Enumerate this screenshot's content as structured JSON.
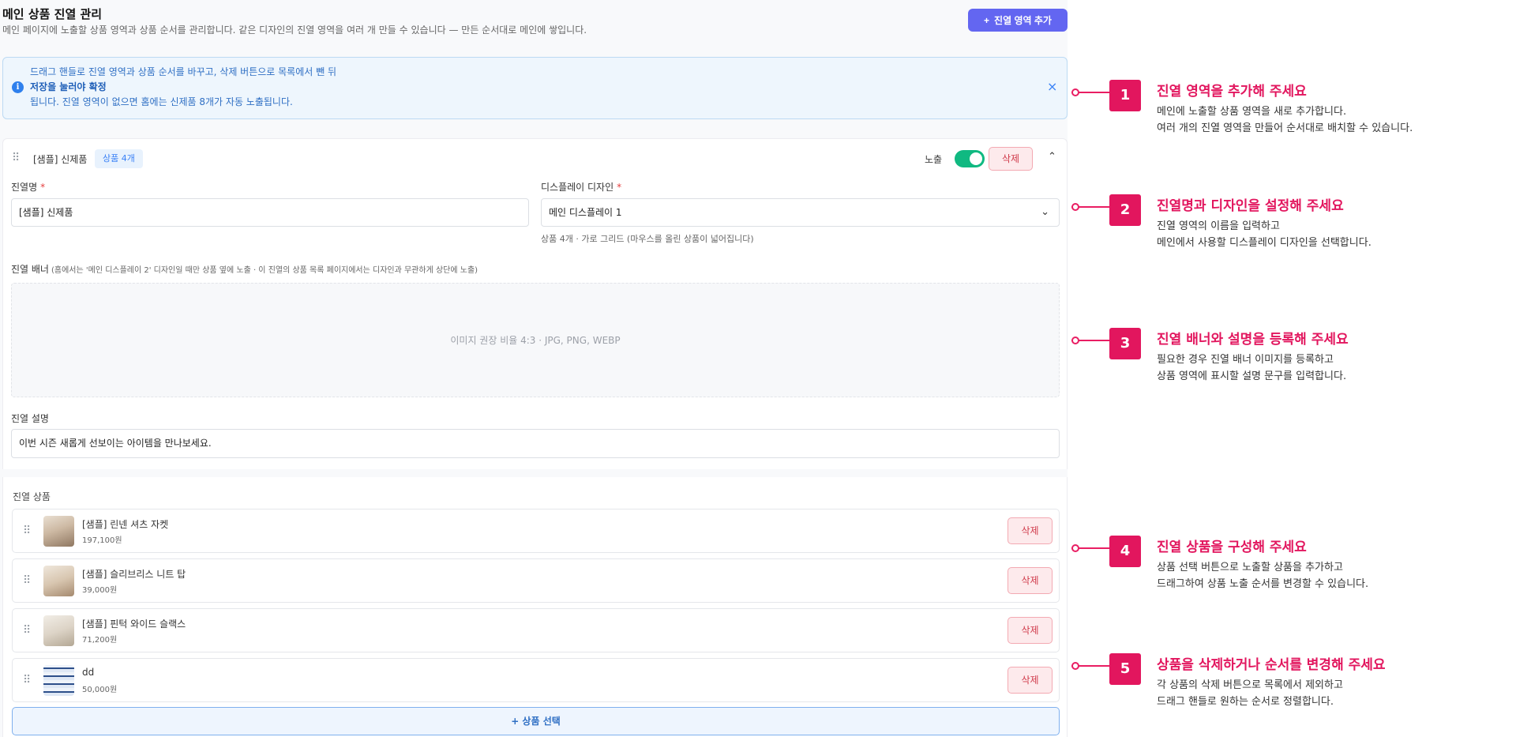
{
  "header": {
    "title": "메인 상품 진열 관리",
    "subtitle": "메인 페이지에 노출할 상품 영역과 상품 순서를 관리합니다. 같은 디자인의 진열 영역을 여러 개 만들 수 있습니다 — 만든 순서대로 메인에 쌓입니다.",
    "add_button": "진열 영역 추가",
    "add_button_icon": "+"
  },
  "info": {
    "line1": "드래그 핸들로 진열 영역과 상품 순서를 바꾸고, 삭제 버튼으로 목록에서 뺀 뒤",
    "line2": "저장을 눌러야 확정",
    "line3": "됩니다. 진열 영역이 없으면 홈에는 신제품 8개가 자동 노출됩니다.",
    "icon": "i",
    "close": "×"
  },
  "section": {
    "drag": "⠿",
    "title": "[샘플] 신제품",
    "badge": "상품 4개",
    "expose_label": "노출",
    "toggle_on": true,
    "delete": "삭제",
    "collapse": "⌃",
    "name_label": "진열명",
    "name_value": "[샘플] 신제품",
    "design_label": "디스플레이 디자인",
    "design_value": "메인 디스플레이 1",
    "design_helper": "상품 4개 · 가로 그리드 (마우스를 올린 상품이 넓어집니다)",
    "banner_label": "진열 배너",
    "banner_hint": "(홈에서는 '메인 디스플레이 2' 디자인일 때만 상품 옆에 노출 · 이 진열의 상품 목록 페이지에서는 디자인과 무관하게 상단에 노출)",
    "upload_hint": "이미지 권장 비율 4:3 · JPG, PNG, WEBP",
    "desc_label": "진열 설명",
    "desc_value": "이번 시즌 새롭게 선보이는 아이템을 만나보세요.",
    "required_mark": "*",
    "chevron": "⌄"
  },
  "products": {
    "label": "진열 상품",
    "items": [
      {
        "name": "[샘플] 린넨 셔츠 자켓",
        "price": "197,100원",
        "delete": "삭제"
      },
      {
        "name": "[샘플] 슬리브리스 니트 탑",
        "price": "39,000원",
        "delete": "삭제"
      },
      {
        "name": "[샘플] 핀턱 와이드 슬랙스",
        "price": "71,200원",
        "delete": "삭제"
      },
      {
        "name": "dd",
        "price": "50,000원",
        "delete": "삭제"
      }
    ],
    "select_button": "+ 상품 선택"
  },
  "callouts": [
    {
      "num": "1",
      "title": "진열 영역을 추가해 주세요",
      "desc1": "메인에 노출할 상품 영역을 새로 추가합니다.",
      "desc2": "여러 개의 진열 영역을 만들어 순서대로 배치할 수 있습니다."
    },
    {
      "num": "2",
      "title": "진열명과 디자인을 설정해 주세요",
      "desc1": "진열 영역의 이름을 입력하고",
      "desc2": "메인에서 사용할 디스플레이 디자인을 선택합니다."
    },
    {
      "num": "3",
      "title": "진열 배너와 설명을 등록해 주세요",
      "desc1": "필요한 경우 진열 배너 이미지를 등록하고",
      "desc2": "상품 영역에 표시할 설명 문구를 입력합니다."
    },
    {
      "num": "4",
      "title": "진열 상품을 구성해 주세요",
      "desc1": "상품 선택 버튼으로 노출할 상품을 추가하고",
      "desc2": "드래그하여 상품 노출 순서를 변경할 수 있습니다."
    },
    {
      "num": "5",
      "title": "상품을 삭제하거나 순서를 변경해 주세요",
      "desc1": "각 상품의 삭제 버튼으로 목록에서 제외하고",
      "desc2": "드래그 핸들로 원하는 순서로 정렬합니다."
    }
  ],
  "colors": {
    "accent": "#6366f1",
    "callout": "#e2165e",
    "toggle": "#10b981",
    "delete": "#d03a4a"
  }
}
